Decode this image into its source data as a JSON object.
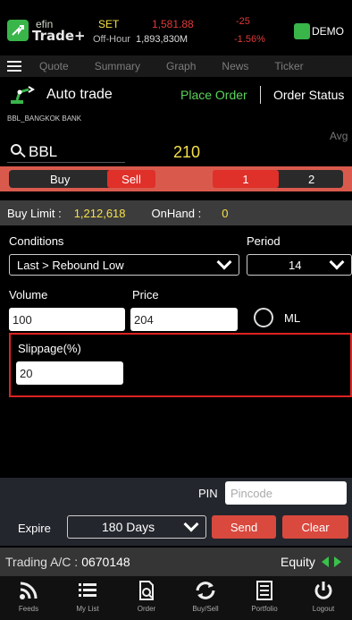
{
  "header": {
    "brand_small": "efin",
    "brand_main": "Trade+",
    "market": "SET",
    "status": "Off-Hour",
    "index_value": "1,581.88",
    "volume": "1,893,830M",
    "change": "-25",
    "change_pct": "-1.56%",
    "mode": "DEMO"
  },
  "nav": {
    "items": [
      {
        "label": "Quote"
      },
      {
        "label": "Summary"
      },
      {
        "label": "Graph"
      },
      {
        "label": "News"
      },
      {
        "label": "Ticker"
      }
    ]
  },
  "autotrade": {
    "title": "Auto trade",
    "place_order": "Place Order",
    "order_status": "Order Status"
  },
  "stock": {
    "bank_label": "BBL_BANGKOK BANK",
    "symbol": "BBL",
    "price": "210",
    "avg_label": "Avg"
  },
  "segments": {
    "buy": "Buy",
    "sell": "Sell",
    "one": "1",
    "two": "2"
  },
  "limits": {
    "buy_limit_label": "Buy Limit :",
    "buy_limit_value": "1,212,618",
    "onhand_label": "OnHand :",
    "onhand_value": "0"
  },
  "form": {
    "conditions_label": "Conditions",
    "condition_value": "Last > Rebound Low",
    "period_label": "Period",
    "period_value": "14",
    "volume_label": "Volume",
    "volume_value": "100",
    "price_label": "Price",
    "price_value": "204",
    "ml_label": "ML",
    "slippage_label": "Slippage(%)",
    "slippage_value": "20"
  },
  "bottom": {
    "pin_label": "PIN",
    "pin_placeholder": "Pincode",
    "expire_label": "Expire",
    "expire_value": "180 Days",
    "send": "Send",
    "clear": "Clear",
    "account_label": "Trading A/C :",
    "account_no": "0670148",
    "equity": "Equity"
  },
  "tabs": [
    {
      "label": "Feeds",
      "icon": "rss-icon"
    },
    {
      "label": "My List",
      "icon": "list-icon"
    },
    {
      "label": "Order",
      "icon": "document-icon"
    },
    {
      "label": "Buy/Sell",
      "icon": "swap-icon"
    },
    {
      "label": "Portfolio",
      "icon": "portfolio-icon"
    },
    {
      "label": "Logout",
      "icon": "power-icon"
    }
  ],
  "colors": {
    "accent_red": "#d95a4d",
    "sell_red": "#e0302a",
    "positive_green": "#5ad35a",
    "highlight_yellow": "#f5e04a"
  }
}
